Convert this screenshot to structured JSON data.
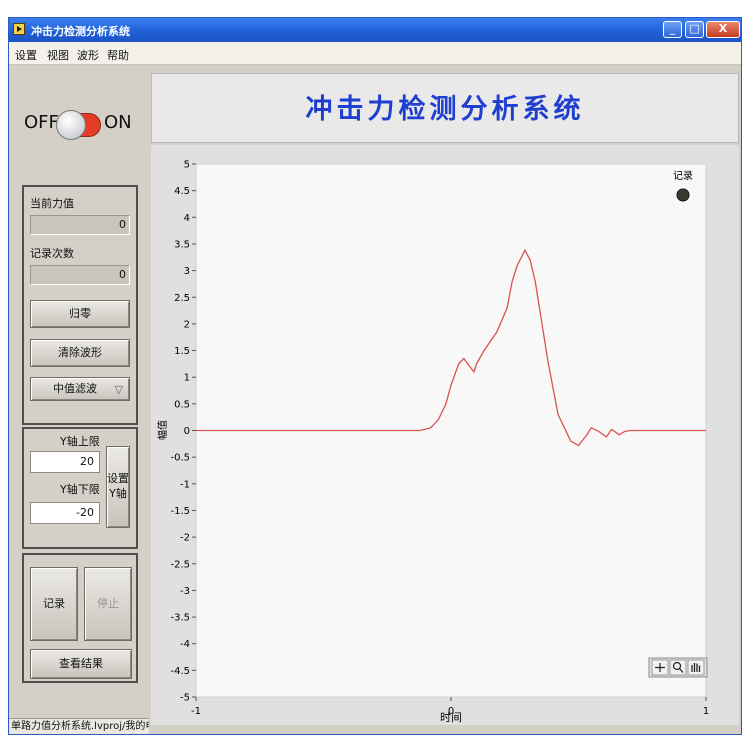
{
  "window": {
    "title": "冲击力检测分析系统",
    "buttons": {
      "minimize": "_",
      "maximize": "□",
      "close": "X"
    }
  },
  "menu": [
    "设置",
    "视图",
    "波形",
    "帮助"
  ],
  "power_switch": {
    "off_label": "OFF",
    "on_label": "ON"
  },
  "readout": {
    "force_label": "当前力值",
    "force_value": "0",
    "count_label": "记录次数",
    "count_value": "0"
  },
  "controls": {
    "zero_button": "归零",
    "clear_button": "清除波形",
    "filter_select": "中值滤波"
  },
  "y_axis": {
    "upper_label": "Y轴上限",
    "upper_value": "20",
    "lower_label": "Y轴下限",
    "lower_value": "-20",
    "set_button_l1": "设置",
    "set_button_l2": "Y轴"
  },
  "actions": {
    "record_button": "记录",
    "stop_button": "停止",
    "view_button": "查看结果"
  },
  "status_text": "单路力值分析系统.lvproj/我的电脑",
  "header": {
    "title": "冲击力检测分析系统"
  },
  "chart": {
    "record_indicator_label": "记录",
    "colors": {
      "plot_bg": "#f8f8f8",
      "frame": "#e0e0e0",
      "trace": "#d9534f",
      "title": "#1f3fd0"
    }
  },
  "chart_data": {
    "type": "line",
    "xlabel": "时间",
    "ylabel": "幅值",
    "xlim": [
      -1,
      1
    ],
    "ylim": [
      -5,
      5
    ],
    "x_ticks": [
      "-1",
      "0",
      "1"
    ],
    "y_ticks": [
      "5",
      "4.5",
      "4",
      "3.5",
      "3",
      "2.5",
      "2",
      "1.5",
      "1",
      "0.5",
      "0",
      "-0.5",
      "-1",
      "-1.5",
      "-2",
      "-2.5",
      "-3",
      "-3.5",
      "-4",
      "-4.5",
      "-5"
    ],
    "series": [
      {
        "color": "#d9534f",
        "x": [
          -1,
          -0.12,
          -0.08,
          -0.05,
          -0.02,
          0.0,
          0.03,
          0.05,
          0.07,
          0.09,
          0.1,
          0.13,
          0.18,
          0.22,
          0.24,
          0.26,
          0.29,
          0.31,
          0.33,
          0.35,
          0.38,
          0.42,
          0.47,
          0.5,
          0.53,
          0.55,
          0.58,
          0.61,
          0.63,
          0.66,
          0.68,
          0.7,
          0.73,
          1.0
        ],
        "y": [
          0,
          0,
          0.05,
          0.2,
          0.5,
          0.85,
          1.25,
          1.35,
          1.22,
          1.1,
          1.25,
          1.5,
          1.85,
          2.3,
          2.8,
          3.1,
          3.38,
          3.2,
          2.8,
          2.2,
          1.3,
          0.3,
          -0.2,
          -0.28,
          -0.1,
          0.05,
          -0.02,
          -0.12,
          0.02,
          -0.08,
          -0.02,
          0.0,
          0.0,
          0.0
        ]
      }
    ]
  }
}
